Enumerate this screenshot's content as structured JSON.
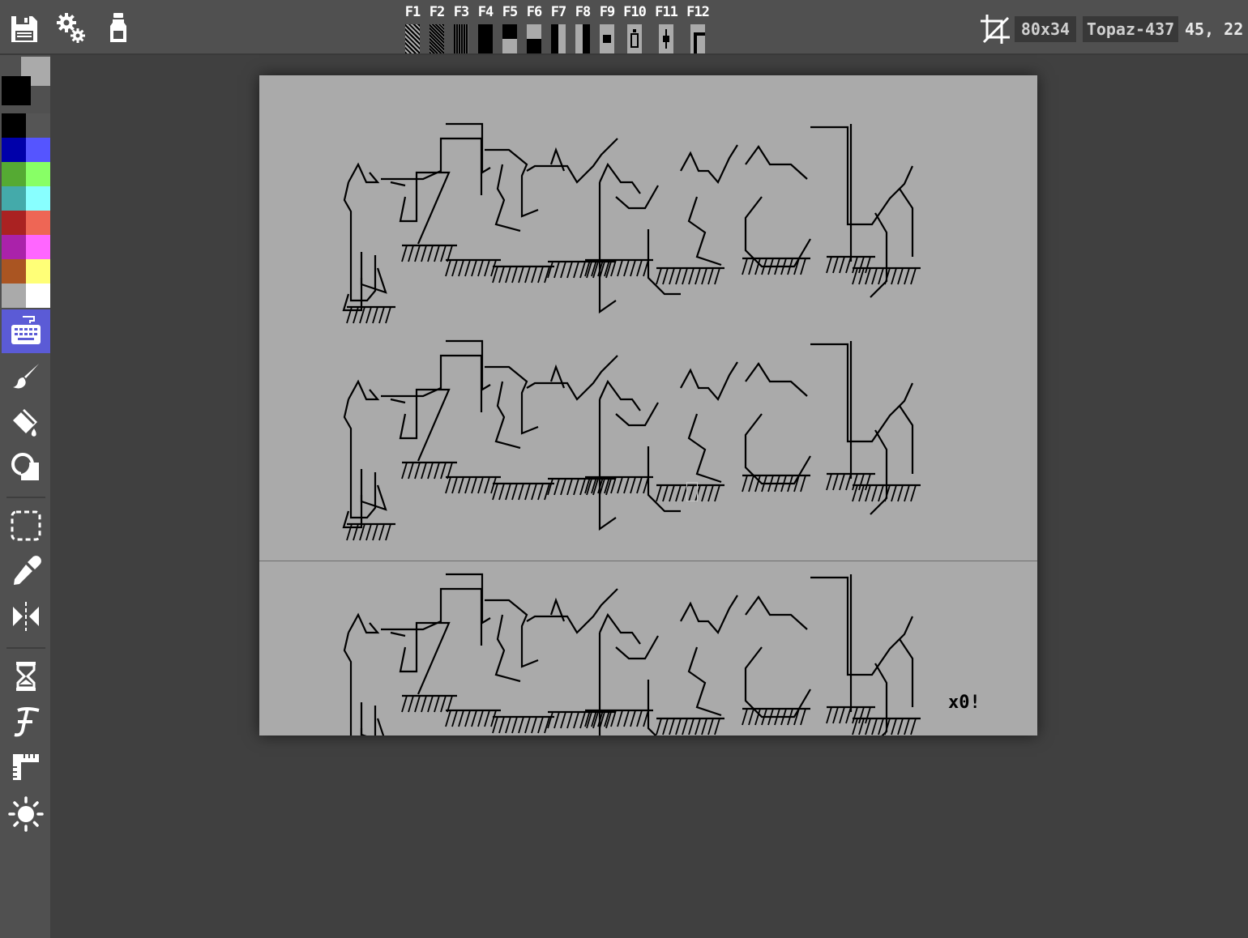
{
  "toolbar": {
    "fkeys": [
      {
        "label": "F1",
        "glyph": "light-shade-block"
      },
      {
        "label": "F2",
        "glyph": "medium-shade-block"
      },
      {
        "label": "F3",
        "glyph": "dark-shade-block"
      },
      {
        "label": "F4",
        "glyph": "full-block"
      },
      {
        "label": "F5",
        "glyph": "upper-half-block"
      },
      {
        "label": "F6",
        "glyph": "lower-half-block"
      },
      {
        "label": "F7",
        "glyph": "left-half-block"
      },
      {
        "label": "F8",
        "glyph": "right-half-block"
      },
      {
        "label": "F9",
        "glyph": "black-square"
      },
      {
        "label": "F10",
        "glyph": "bottle-glyph"
      },
      {
        "label": "F11",
        "glyph": "diamond-glyph"
      },
      {
        "label": "F12",
        "glyph": "corner-glyph"
      }
    ],
    "canvas_size": "80x34",
    "font_name": "Topaz-437",
    "cursor_position": "45, 22"
  },
  "sidebar": {
    "foreground_color": "#000000",
    "background_color": "#aaaaaa",
    "palette": [
      "#000000",
      "#555555",
      "#0000aa",
      "#5555ff",
      "#55aa33",
      "#88ff66",
      "#44aaaa",
      "#88ffff",
      "#aa2222",
      "#ee6655",
      "#aa22aa",
      "#ff66ff",
      "#aa5522",
      "#ffff77",
      "#aaaaaa",
      "#ffffff"
    ],
    "tools": [
      "keyboard-icon",
      "brush-icon",
      "fill-icon",
      "shapes-icon",
      "selection-icon",
      "eyedropper-icon",
      "mirror-icon",
      "hourglass-icon",
      "font-icon",
      "ruler-icon",
      "brightness-icon"
    ]
  },
  "canvas": {
    "background": "#aaaaaa",
    "signature": "x0!"
  },
  "colors": {
    "toolbar": "#505050",
    "workspace": "#404040",
    "accent": "#5b5bd6"
  }
}
